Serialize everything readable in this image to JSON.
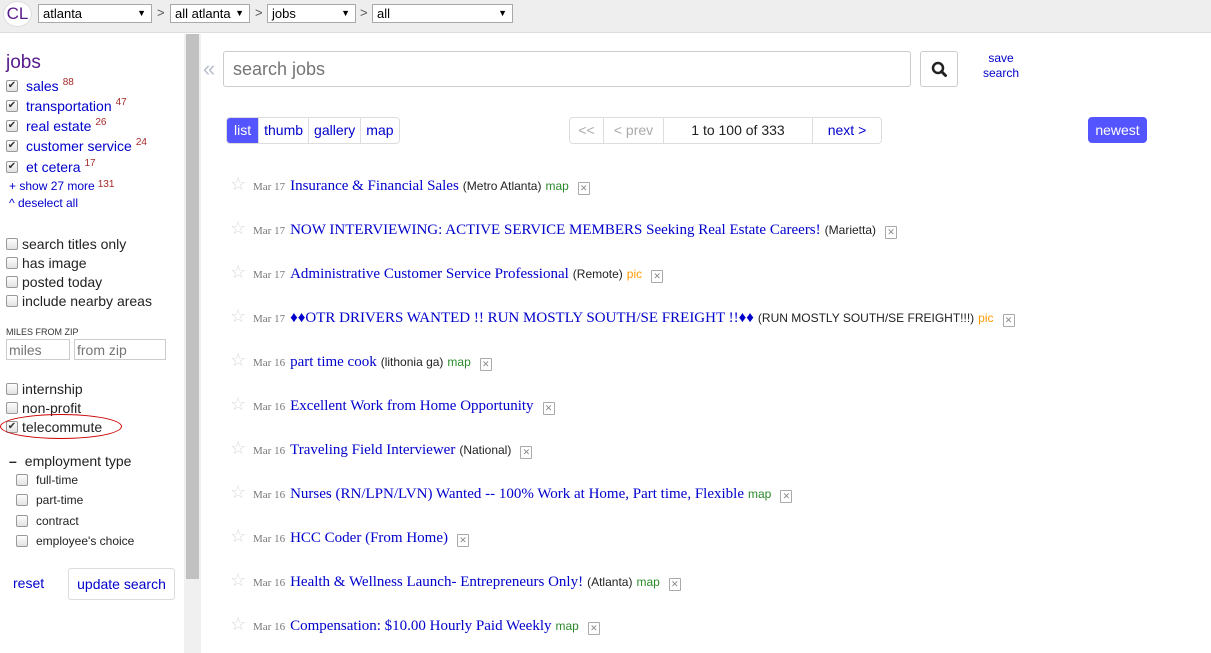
{
  "topbar": {
    "logo": "CL",
    "breadcrumb": [
      {
        "value": "atlanta"
      },
      {
        "value": "all atlanta"
      },
      {
        "value": "jobs"
      },
      {
        "value": "all"
      }
    ],
    "separator": ">"
  },
  "sidebar": {
    "title": "jobs",
    "categories": [
      {
        "label": "sales",
        "count": "88",
        "checked": true
      },
      {
        "label": "transportation",
        "count": "47",
        "checked": true
      },
      {
        "label": "real estate",
        "count": "26",
        "checked": true
      },
      {
        "label": "customer service",
        "count": "24",
        "checked": true
      },
      {
        "label": "et cetera",
        "count": "17",
        "checked": true
      }
    ],
    "show_more": {
      "label": "+ show 27 more",
      "count": "131"
    },
    "deselect_all": "^ deselect all",
    "options": [
      {
        "label": "search titles only",
        "checked": false
      },
      {
        "label": "has image",
        "checked": false
      },
      {
        "label": "posted today",
        "checked": false
      },
      {
        "label": "include nearby areas",
        "checked": false
      }
    ],
    "miles_from_zip": {
      "label": "MILES FROM ZIP",
      "miles_placeholder": "miles",
      "zip_placeholder": "from zip"
    },
    "extra_options": [
      {
        "label": "internship",
        "checked": false
      },
      {
        "label": "non-profit",
        "checked": false
      },
      {
        "label": "telecommute",
        "checked": true
      }
    ],
    "employment_type": {
      "toggle": "–",
      "label": "employment type",
      "items": [
        {
          "label": "full-time",
          "checked": false
        },
        {
          "label": "part-time",
          "checked": false
        },
        {
          "label": "contract",
          "checked": false
        },
        {
          "label": "employee's choice",
          "checked": false
        }
      ]
    },
    "reset_label": "reset",
    "update_label": "update search"
  },
  "main": {
    "collapse_icon": "«",
    "search_placeholder": "search jobs",
    "save_search": "save search",
    "views": [
      "list",
      "thumb",
      "gallery",
      "map"
    ],
    "active_view": "list",
    "pager": {
      "first": "<<",
      "prev": "< prev",
      "range": "1 to 100 of 333",
      "next": "next >"
    },
    "sort_label": "newest",
    "listings": [
      {
        "date": "Mar 17",
        "title": "Insurance & Financial Sales",
        "hood": "(Metro Atlanta)",
        "tag": "map"
      },
      {
        "date": "Mar 17",
        "title": "NOW INTERVIEWING: ACTIVE SERVICE MEMBERS Seeking Real Estate Careers!",
        "hood": "(Marietta)",
        "tag": ""
      },
      {
        "date": "Mar 17",
        "title": "Administrative Customer Service Professional",
        "hood": "(Remote)",
        "tag": "pic"
      },
      {
        "date": "Mar 17",
        "title": "♦♦OTR DRIVERS WANTED !! RUN MOSTLY SOUTH/SE FREIGHT !!♦♦",
        "hood": "(RUN MOSTLY SOUTH/SE FREIGHT!!!)",
        "tag": "pic"
      },
      {
        "date": "Mar 16",
        "title": "part time cook",
        "hood": "(lithonia ga)",
        "tag": "map"
      },
      {
        "date": "Mar 16",
        "title": "Excellent Work from Home Opportunity",
        "hood": "",
        "tag": ""
      },
      {
        "date": "Mar 16",
        "title": "Traveling Field Interviewer",
        "hood": "(National)",
        "tag": ""
      },
      {
        "date": "Mar 16",
        "title": "Nurses (RN/LPN/LVN) Wanted -- 100% Work at Home, Part time, Flexible",
        "hood": "",
        "tag": "map"
      },
      {
        "date": "Mar 16",
        "title": "HCC Coder (From Home)",
        "hood": "",
        "tag": ""
      },
      {
        "date": "Mar 16",
        "title": "Health & Wellness Launch- Entrepreneurs Only!",
        "hood": "(Atlanta)",
        "tag": "map"
      },
      {
        "date": "Mar 16",
        "title": "Compensation: $10.00 Hourly Paid Weekly",
        "hood": "",
        "tag": "map"
      }
    ]
  },
  "colors": {
    "link": "#0000cc",
    "accent": "#5555ff",
    "count": "#a52a2a",
    "map_tag": "#2a8a2a",
    "pic_tag": "#ff9900",
    "highlight_ellipse": "#cc0000"
  }
}
